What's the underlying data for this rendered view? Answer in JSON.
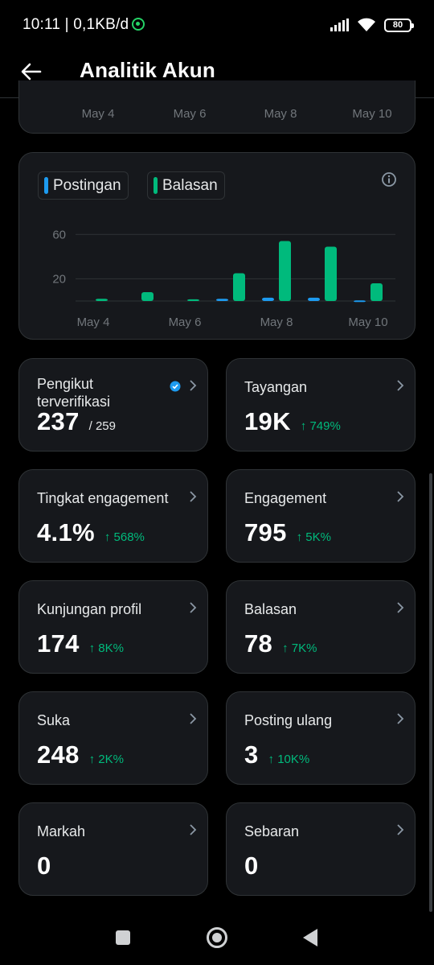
{
  "status_bar": {
    "time": "10:11 | 0,1KB/d",
    "battery": "80"
  },
  "header": {
    "title": "Analitik Akun"
  },
  "top_chart_axis": [
    "May 4",
    "May 6",
    "May 8",
    "May 10"
  ],
  "colors": {
    "postingan": "#1d9bf0",
    "balasan": "#00ba7c",
    "positive_change": "#00ba7c"
  },
  "chart_data": {
    "type": "bar",
    "categories": [
      "May 4",
      "May 5",
      "May 6",
      "May 7",
      "May 8",
      "May 9",
      "May 10"
    ],
    "series": [
      {
        "name": "Postingan",
        "values": [
          0,
          0,
          0,
          2,
          3,
          3,
          0.5
        ]
      },
      {
        "name": "Balasan",
        "values": [
          2,
          8,
          1.5,
          25,
          54,
          49,
          16
        ]
      }
    ],
    "y_ticks": [
      "20",
      "60"
    ],
    "x_ticks": [
      "May 4",
      "May 6",
      "May 8",
      "May 10"
    ],
    "ylim": [
      0,
      66
    ],
    "grid": true,
    "legend": "top-left"
  },
  "metrics": [
    {
      "label": "Pengikut terverifikasi",
      "value": "237",
      "sub": "/ 259",
      "change": ""
    },
    {
      "label": "Tayangan",
      "value": "19K",
      "sub": "",
      "change": "↑ 749%"
    },
    {
      "label": "Tingkat engagement",
      "value": "4.1%",
      "sub": "",
      "change": "↑ 568%"
    },
    {
      "label": "Engagement",
      "value": "795",
      "sub": "",
      "change": "↑ 5K%"
    },
    {
      "label": "Kunjungan profil",
      "value": "174",
      "sub": "",
      "change": "↑ 8K%"
    },
    {
      "label": "Balasan",
      "value": "78",
      "sub": "",
      "change": "↑ 7K%"
    },
    {
      "label": "Suka",
      "value": "248",
      "sub": "",
      "change": "↑ 2K%"
    },
    {
      "label": "Posting ulang",
      "value": "3",
      "sub": "",
      "change": "↑ 10K%"
    },
    {
      "label": "Markah",
      "value": "0",
      "sub": "",
      "change": ""
    },
    {
      "label": "Sebaran",
      "value": "0",
      "sub": "",
      "change": ""
    }
  ]
}
